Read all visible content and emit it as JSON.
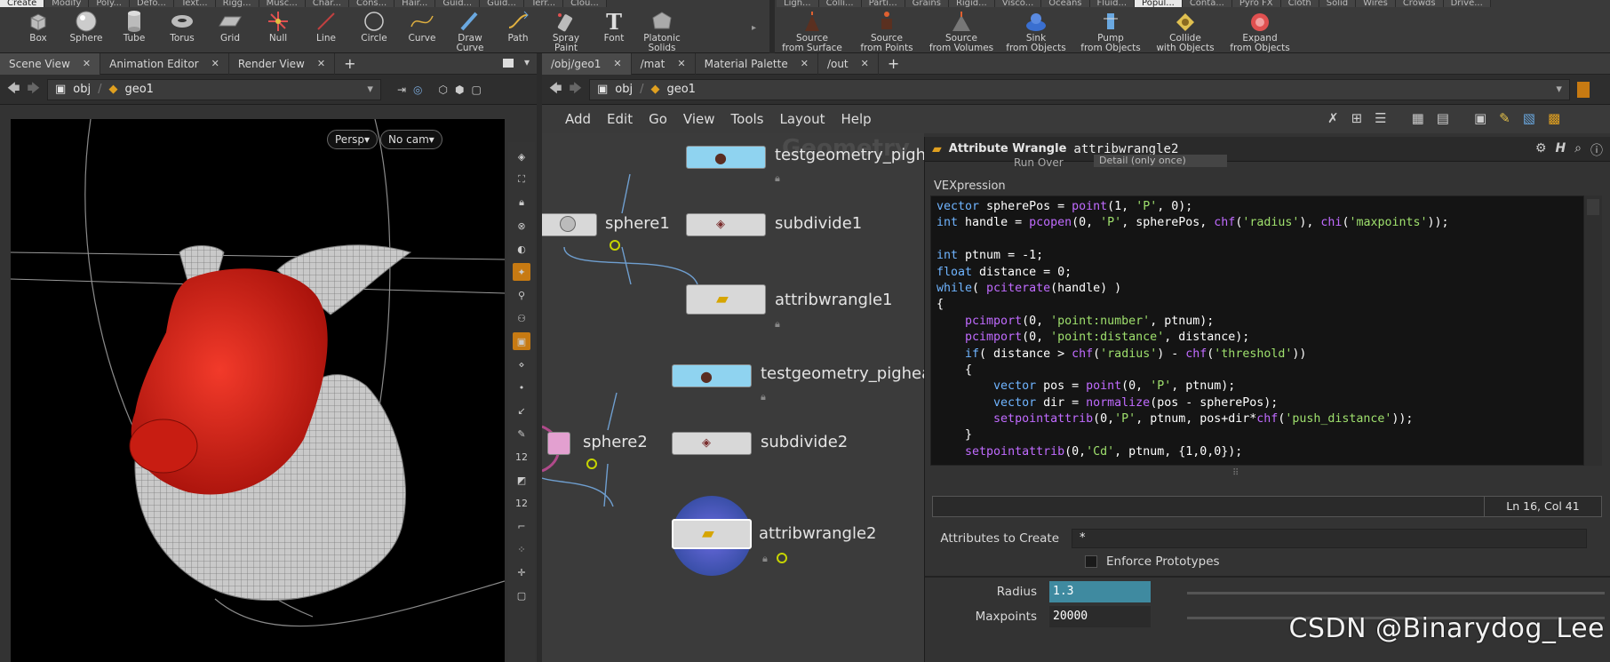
{
  "shelf": {
    "left_tabs": [
      "Create",
      "Modify",
      "Poly...",
      "Defo...",
      "Text...",
      "Rigg...",
      "Musc...",
      "Char...",
      "Cons...",
      "Hair...",
      "Guid...",
      "Guid...",
      "Terr...",
      "Clou..."
    ],
    "left_active": 0,
    "right_tabs": [
      "Ligh...",
      "Colli...",
      "Parti...",
      "Grains",
      "Rigid...",
      "Visco...",
      "Oceans",
      "Fluid...",
      "Popul...",
      "Conta...",
      "Pyro FX",
      "Cloth",
      "Solid",
      "Wires",
      "Crowds",
      "Drive..."
    ],
    "right_active": 8,
    "left_tools": [
      {
        "label": "Box",
        "icon": "box-icon"
      },
      {
        "label": "Sphere",
        "icon": "sphere-icon"
      },
      {
        "label": "Tube",
        "icon": "tube-icon"
      },
      {
        "label": "Torus",
        "icon": "torus-icon"
      },
      {
        "label": "Grid",
        "icon": "grid-icon"
      },
      {
        "label": "Null",
        "icon": "null-icon"
      },
      {
        "label": "Line",
        "icon": "line-icon"
      },
      {
        "label": "Circle",
        "icon": "circle-icon"
      },
      {
        "label": "Curve",
        "icon": "curve-icon"
      },
      {
        "label": "Draw Curve",
        "icon": "draw-curve-icon"
      },
      {
        "label": "Path",
        "icon": "path-icon"
      },
      {
        "label": "Spray Paint",
        "icon": "spray-paint-icon"
      },
      {
        "label": "Font",
        "icon": "font-icon"
      },
      {
        "label": "Platonic\nSolids",
        "icon": "platonic-solids-icon"
      }
    ],
    "right_tools": [
      {
        "label": "Source\nfrom Surface",
        "icon": "source-surface-icon"
      },
      {
        "label": "Source\nfrom Points",
        "icon": "source-points-icon"
      },
      {
        "label": "Source\nfrom Volumes",
        "icon": "source-volumes-icon"
      },
      {
        "label": "Sink\nfrom Objects",
        "icon": "sink-icon"
      },
      {
        "label": "Pump\nfrom Objects",
        "icon": "pump-icon"
      },
      {
        "label": "Collide\nwith Objects",
        "icon": "collide-icon"
      },
      {
        "label": "Expand\nfrom Objects",
        "icon": "expand-icon"
      }
    ]
  },
  "left_pane": {
    "tabs": [
      {
        "label": "Scene View"
      },
      {
        "label": "Animation Editor"
      },
      {
        "label": "Render View"
      }
    ],
    "path": {
      "root": "obj",
      "node": "geo1"
    },
    "viewport": {
      "persp": "Persp▾",
      "cam": "No cam▾"
    }
  },
  "net_pane": {
    "tabs": [
      {
        "label": "/obj/geo1"
      },
      {
        "label": "/mat"
      },
      {
        "label": "Material Palette"
      },
      {
        "label": "/out"
      }
    ],
    "path": {
      "root": "obj",
      "node": "geo1"
    },
    "menu": [
      "Add",
      "Edit",
      "Go",
      "View",
      "Tools",
      "Layout",
      "Help"
    ],
    "watermark": "Geometry",
    "nodes": {
      "testgeo1": "testgeometry_pighe",
      "sphere1": "sphere1",
      "subdivide1": "subdivide1",
      "wrangle1": "attribwrangle1",
      "testgeo2": "testgeometry_pighea",
      "sphere2": "sphere2",
      "subdivide2": "subdivide2",
      "wrangle2": "attribwrangle2"
    }
  },
  "params": {
    "node_type": "Attribute Wrangle",
    "node_name": "attribwrangle2",
    "run_over_label": "Run Over",
    "run_over_value": "Detail (only once)",
    "vex_label": "VEXpression",
    "cursor_pos": "Ln 16, Col 41",
    "attrs_label": "Attributes to Create",
    "attrs_value": "*",
    "enforce_label": "Enforce Prototypes",
    "radius_label": "Radius",
    "radius_value": "1.3",
    "maxpoints_label": "Maxpoints",
    "maxpoints_value": "20000"
  },
  "code": [
    "vector spherePos = point(1, 'P', 0);",
    "int handle = pcopen(0, 'P', spherePos, chf('radius'), chi('maxpoints'));",
    "",
    "int ptnum = -1;",
    "float distance = 0;",
    "while( pciterate(handle) )",
    "{",
    "    pcimport(0, 'point:number', ptnum);",
    "    pcimport(0, 'point:distance', distance);",
    "    if( distance > chf('radius') - chf('threshold'))",
    "    {",
    "        vector pos = point(0, 'P', ptnum);",
    "        vector dir = normalize(pos - spherePos);",
    "        setpointattrib(0,'P', ptnum, pos+dir*chf('push_distance'));",
    "    }",
    "    setpointattrib(0,'Cd', ptnum, {1,0,0});",
    "",
    "}"
  ],
  "watermark_text": "CSDN @Binarydog_Lee",
  "colors": {
    "accent": "#c77a12",
    "selected_field": "#3f8aa0",
    "vex_keyword": "#6fb4ff",
    "vex_function": "#c06bff",
    "vex_string": "#9fe06d"
  }
}
